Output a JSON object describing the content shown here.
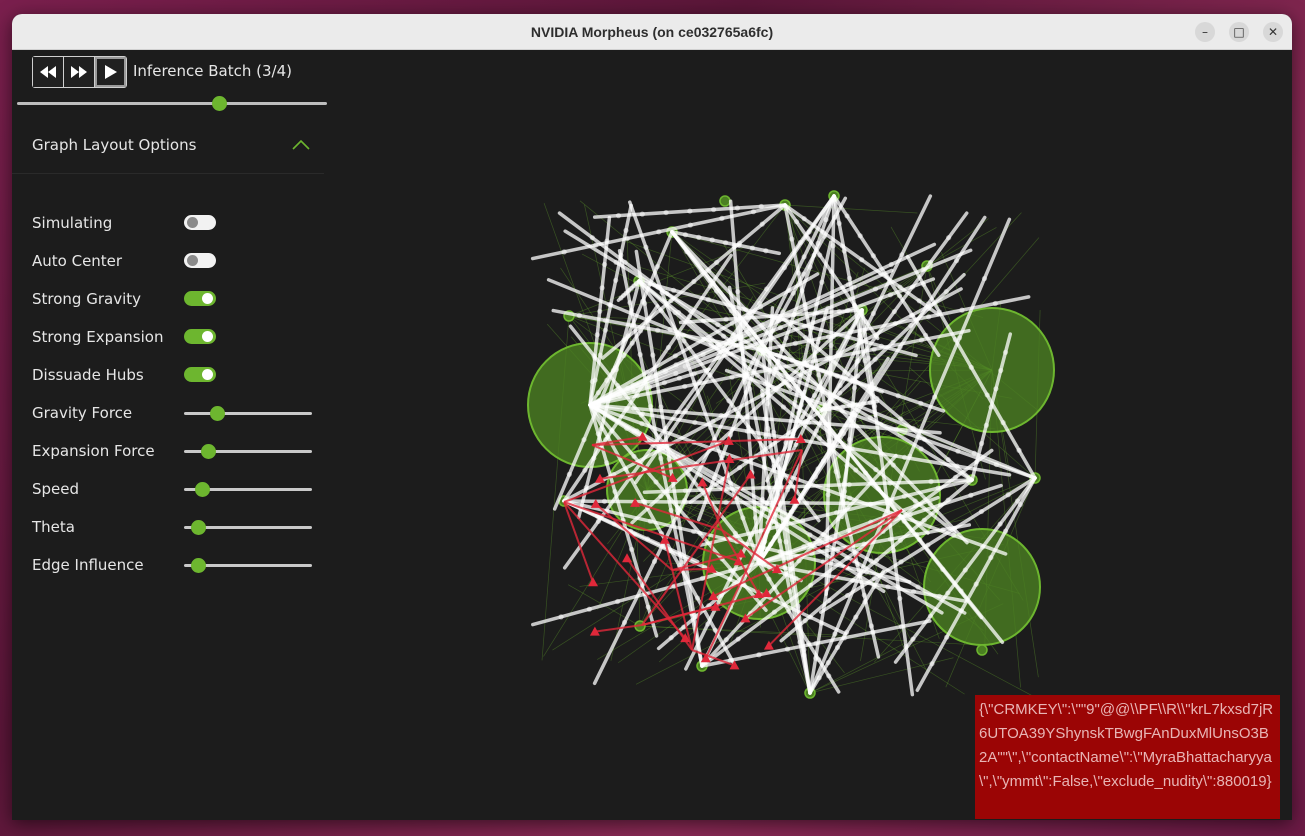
{
  "window": {
    "title": "NVIDIA Morpheus (on ce032765a6fc)",
    "controls": [
      {
        "name": "minimize",
        "glyph": "–"
      },
      {
        "name": "maximize",
        "glyph": "□"
      },
      {
        "name": "close",
        "glyph": "✕"
      }
    ]
  },
  "transport": {
    "buttons": [
      "rewind-icon",
      "fast-forward-icon",
      "play-icon"
    ],
    "batch_label": "Inference Batch (3/4)",
    "batch_position": 0.66
  },
  "layout_options": {
    "title": "Graph Layout Options",
    "toggles": [
      {
        "label": "Simulating",
        "on": false
      },
      {
        "label": "Auto Center",
        "on": false
      },
      {
        "label": "Strong Gravity",
        "on": true
      },
      {
        "label": "Strong Expansion",
        "on": true
      },
      {
        "label": "Dissuade Hubs",
        "on": true
      }
    ],
    "sliders": [
      {
        "label": "Gravity Force",
        "value": 0.23
      },
      {
        "label": "Expansion Force",
        "value": 0.15
      },
      {
        "label": "Speed",
        "value": 0.1
      },
      {
        "label": "Theta",
        "value": 0.06
      },
      {
        "label": "Edge Influence",
        "value": 0.06
      }
    ]
  },
  "colors": {
    "accent": "#6db62f",
    "node_fill": "#4b7f22",
    "edge_white": "#ffffff",
    "anomaly_red": "#e0283a",
    "message_bg": "#9b0505"
  },
  "graph": {
    "hubs": [
      {
        "name": "hub-node-1"
      },
      {
        "name": "hub-node-2"
      },
      {
        "name": "hub-node-3"
      },
      {
        "name": "hub-node-4"
      },
      {
        "name": "hub-node-5"
      },
      {
        "name": "hub-node-6"
      }
    ]
  },
  "message": {
    "text": "{\\\"CRMKEY\\\":\\\"\"9\"@@\\\\PF\\\\R\\\\\"krL7kxsd7jR6UTOA39YShynskTBwgFAnDuxMlUnsO3B2A\"\"\\\",\\\"contactName\\\":\\\"MyraBhattacharyya\\\",\\\"ymmt\\\":False,\\\"exclude_nudity\\\":880019}"
  }
}
